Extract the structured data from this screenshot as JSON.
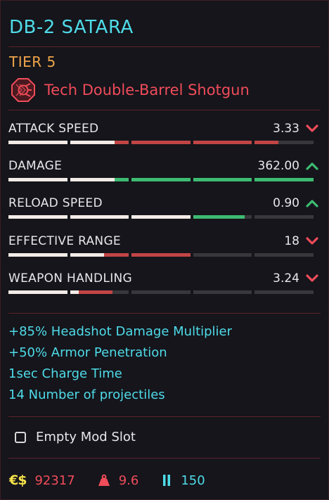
{
  "item": {
    "name": "DB-2 SATARA",
    "tier": "TIER 5",
    "type_label": "Tech Double-Barrel Shotgun",
    "type_icon": "tech-weapon-icon"
  },
  "stats": [
    {
      "name": "ATTACK SPEED",
      "value": "3.33",
      "trend": "down",
      "bar": {
        "base": 0.352,
        "compare": 0.88,
        "mode": "decrease"
      }
    },
    {
      "name": "DAMAGE",
      "value": "362.00",
      "trend": "up",
      "bar": {
        "base": 0.352,
        "compare": 1.0,
        "mode": "increase"
      }
    },
    {
      "name": "RELOAD SPEED",
      "value": "0.90",
      "trend": "up",
      "bar": {
        "base": 0.6,
        "compare": 0.775,
        "mode": "increase"
      }
    },
    {
      "name": "EFFECTIVE RANGE",
      "value": "18",
      "trend": "down",
      "bar": {
        "base": 0.315,
        "compare": 0.6,
        "mode": "decrease"
      }
    },
    {
      "name": "WEAPON HANDLING",
      "value": "3.24",
      "trend": "down",
      "bar": {
        "base": 0.23,
        "compare": 0.345,
        "mode": "decrease"
      }
    }
  ],
  "modifiers": [
    "+85% Headshot Damage Multiplier",
    "+50% Armor Penetration",
    "1sec Charge Time",
    "14 Number of projectiles"
  ],
  "mod_slot": {
    "label": "Empty Mod Slot",
    "checked": false
  },
  "footer": {
    "currency_symbol": "€$",
    "price": "92317",
    "weight": "9.6",
    "ammo": "150"
  },
  "colors": {
    "accent_cyan": "#4fdbe8",
    "tier_orange": "#f0a64b",
    "alert_red": "#f04c5a",
    "increase_green": "#3dbb72",
    "decrease_red": "#c24545",
    "base_white": "#f3ebe6",
    "empty_gray": "#38383c"
  }
}
